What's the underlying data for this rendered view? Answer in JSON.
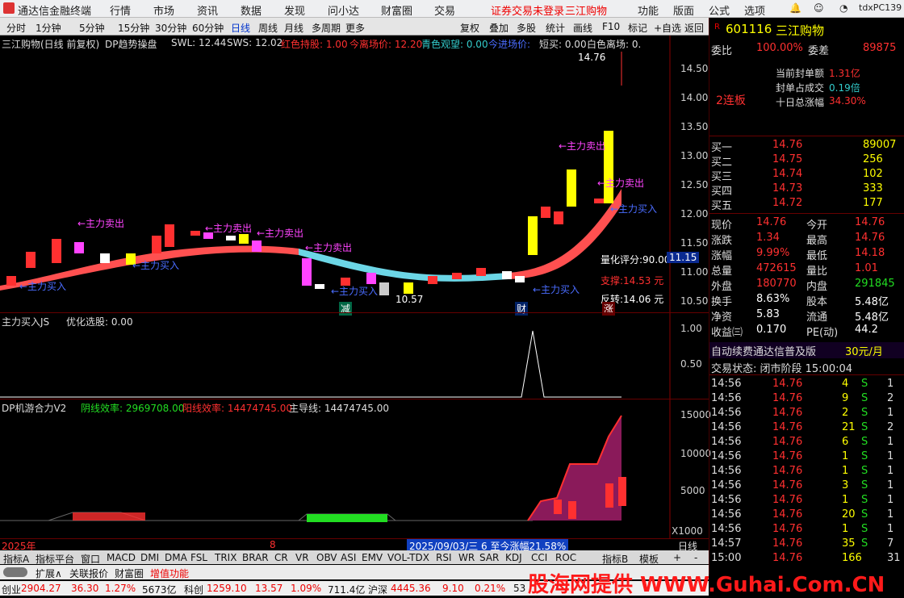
{
  "menu": {
    "app": "通达信金融终端",
    "items": [
      "行情",
      "市场",
      "资讯",
      "数据",
      "发现",
      "问小达",
      "财富圈",
      "交易"
    ],
    "notice": "证券交易未登录",
    "stock_link": "三江购物",
    "right": [
      "功能",
      "版面",
      "公式",
      "选项"
    ],
    "user": "tdxPC139"
  },
  "periods": [
    "分时",
    "1分钟",
    "5分钟",
    "15分钟",
    "30分钟",
    "60分钟",
    "日线",
    "周线",
    "月线",
    "多周期",
    "更多"
  ],
  "tools": [
    "复权",
    "叠加",
    "多股",
    "统计",
    "画线",
    "F10",
    "标记",
    "+自选",
    "返回"
  ],
  "main_header": {
    "name": "三江购物(日线 前复权)",
    "ind": "DP趋势操盘",
    "swl": "SWL: 12.44",
    "sws": "SWS: 12.02",
    "hold": "红色持股: 1.00",
    "leave": "今离场价: 12.20",
    "watch": "青色观望: 0.00",
    "enter": "今进场价:",
    "short": "短买: 0.00",
    "white": "白色离场: 0."
  },
  "price_axis": [
    "14.50",
    "14.00",
    "13.50",
    "13.00",
    "12.50",
    "12.00",
    "11.50",
    "11.00",
    "10.50"
  ],
  "annotations": {
    "high": "14.76",
    "low": "10.57",
    "sell": "←主力卖出",
    "buy": "←主力买入",
    "score": "量化评分:90.00",
    "score_val": "11.15",
    "support": "支撑:14.53 元",
    "turn": "反转:14.06 元",
    "marks": [
      "减",
      "财",
      "涨"
    ]
  },
  "sub1": {
    "title": "主力买入JS",
    "opt": "优化选股: 0.00",
    "axis": [
      "1.00",
      "0.50"
    ]
  },
  "sub2": {
    "title": "DP机游合力V2",
    "neg": "阴线效率: 2969708.00",
    "pos": "阳线效率: 14474745.00",
    "main": "主导线: 14474745.00",
    "axis": [
      "15000",
      "10000",
      "5000"
    ],
    "unit": "X1000"
  },
  "date_bar": {
    "year": "2025年",
    "month": "8",
    "range": "2025/09/03/三 6 至今涨幅21.58%",
    "period": "日线"
  },
  "ind_tabs": [
    "指标A",
    "指标平台",
    "窗口",
    "MACD",
    "DMI",
    "DMA",
    "FSL",
    "TRIX",
    "BRAR",
    "CR",
    "VR",
    "OBV",
    "ASI",
    "EMV",
    "VOL-TDX",
    "RSI",
    "WR",
    "SAR",
    "KDJ",
    "CCI",
    "ROC",
    "指标B",
    "模板",
    "+",
    "-"
  ],
  "ext_tabs": [
    "扩展∧",
    "关联报价",
    "财富圈",
    "增值功能"
  ],
  "stock": {
    "code": "601116",
    "name": "三江购物",
    "wb_label": "委比",
    "wb": "100.00%",
    "wc_label": "委差",
    "wc": "89875",
    "seal_label": "当前封单额",
    "seal": "1.31亿",
    "share_label": "封单占成交",
    "share": "0.19倍",
    "ten_label": "十日总涨幅",
    "ten": "34.30%",
    "lianban": "2连板"
  },
  "bids": [
    [
      "买一",
      "14.76",
      "89007"
    ],
    [
      "买二",
      "14.75",
      "256"
    ],
    [
      "买三",
      "14.74",
      "102"
    ],
    [
      "买四",
      "14.73",
      "333"
    ],
    [
      "买五",
      "14.72",
      "177"
    ]
  ],
  "quote": [
    [
      "现价",
      "14.76",
      "今开",
      "14.76"
    ],
    [
      "涨跌",
      "1.34",
      "最高",
      "14.76"
    ],
    [
      "涨幅",
      "9.99%",
      "最低",
      "14.18"
    ],
    [
      "总量",
      "472615",
      "量比",
      "1.01"
    ],
    [
      "外盘",
      "180770",
      "内盘",
      "291845"
    ],
    [
      "换手",
      "8.63%",
      "股本",
      "5.48亿"
    ],
    [
      "净资",
      "5.83",
      "流通",
      "5.48亿"
    ],
    [
      "收益㈢",
      "0.170",
      "PE(动)",
      "44.2"
    ]
  ],
  "ad": {
    "text": "自动续费通达信普及版",
    "price": "30元/月"
  },
  "trade_status": "交易状态: 闭市阶段 15:00:04",
  "ticks": [
    [
      "14:56",
      "14.76",
      "4",
      "S",
      "1"
    ],
    [
      "14:56",
      "14.76",
      "9",
      "S",
      "2"
    ],
    [
      "14:56",
      "14.76",
      "2",
      "S",
      "1"
    ],
    [
      "14:56",
      "14.76",
      "21",
      "S",
      "2"
    ],
    [
      "14:56",
      "14.76",
      "6",
      "S",
      "1"
    ],
    [
      "14:56",
      "14.76",
      "1",
      "S",
      "1"
    ],
    [
      "14:56",
      "14.76",
      "1",
      "S",
      "1"
    ],
    [
      "14:56",
      "14.76",
      "3",
      "S",
      "1"
    ],
    [
      "14:56",
      "14.76",
      "1",
      "S",
      "1"
    ],
    [
      "14:56",
      "14.76",
      "20",
      "S",
      "1"
    ],
    [
      "14:56",
      "14.76",
      "1",
      "S",
      "1"
    ],
    [
      "14:57",
      "14.76",
      "35",
      "S",
      "7"
    ],
    [
      "15:00",
      "14.76",
      "166",
      "",
      "31"
    ]
  ],
  "statusbar": [
    "创业",
    "2904.27",
    "36.30",
    "1.27%",
    "5673亿",
    "科创",
    "1259.10",
    "13.57",
    "1.09%",
    "711.4亿",
    "沪深",
    "4445.36",
    "9.10",
    "0.21%",
    "53"
  ],
  "watermark": "股海网提供 WWW.Guhai.Com.CN",
  "colors": {
    "up": "#ff3030",
    "down": "#3cc",
    "bg": "#000"
  }
}
